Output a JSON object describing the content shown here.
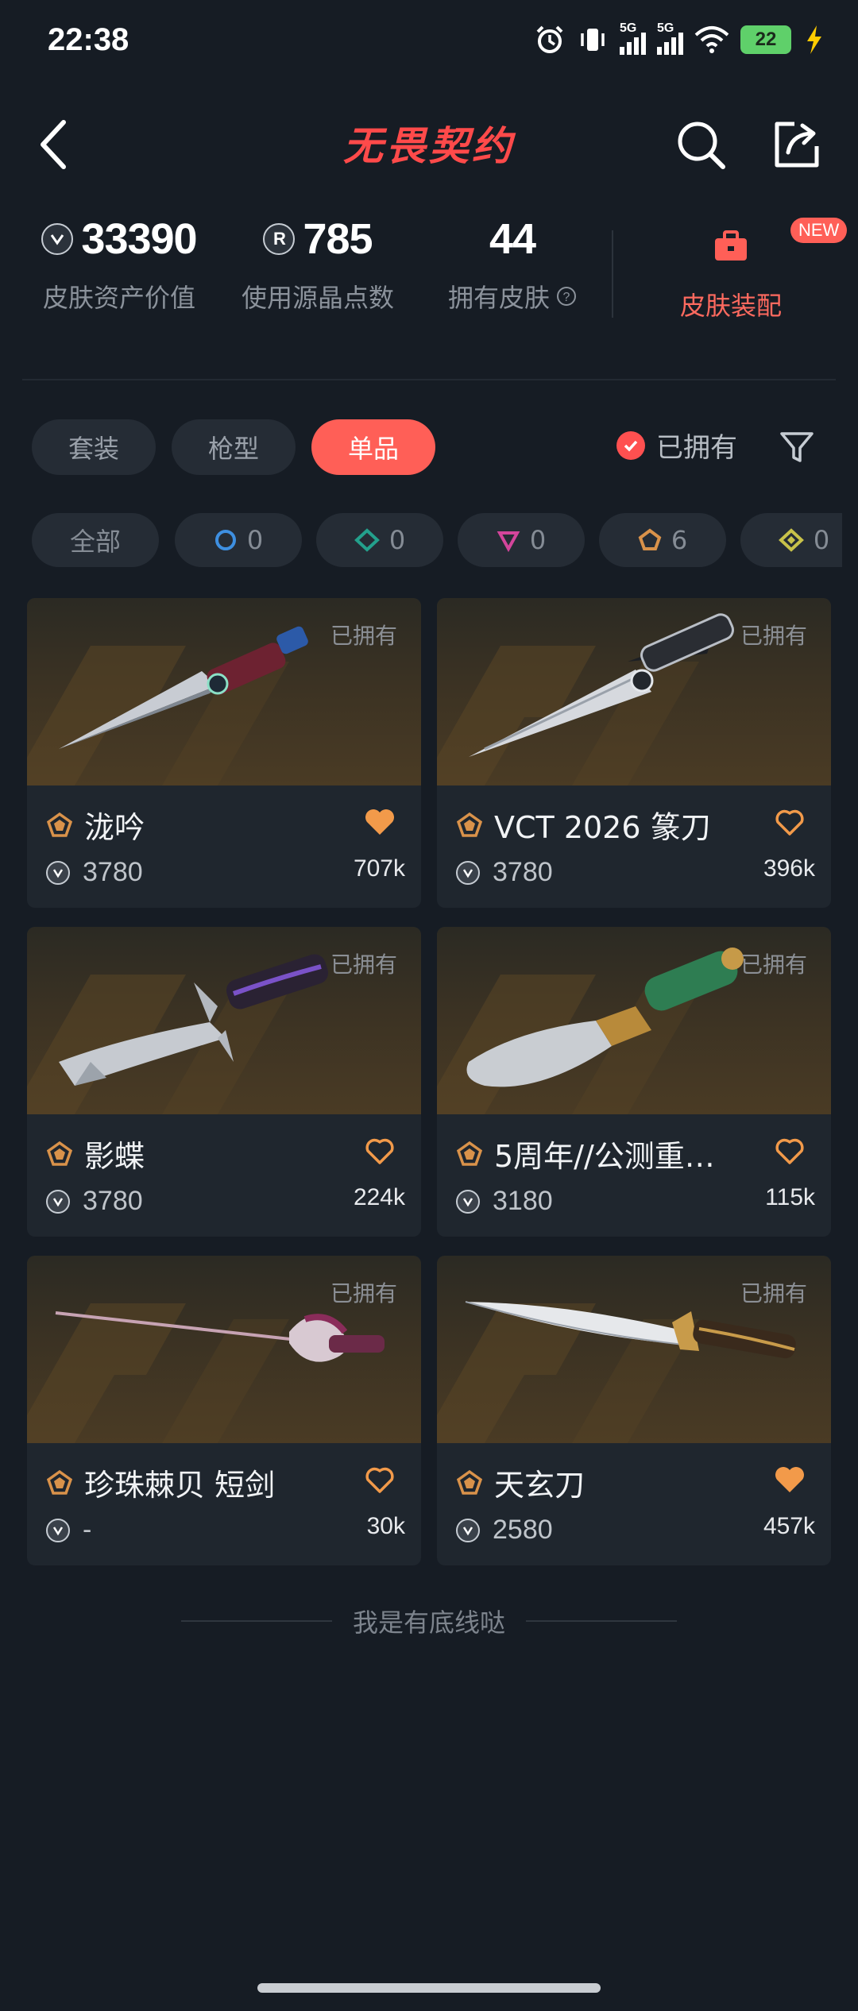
{
  "status": {
    "time": "22:38",
    "battery": "22",
    "signal1": "5G",
    "signal2": "5G"
  },
  "header": {
    "title": "无畏契约"
  },
  "stats": {
    "asset_value": "33390",
    "asset_value_label": "皮肤资产价值",
    "radianite_spent": "785",
    "radianite_spent_label": "使用源晶点数",
    "skins_owned": "44",
    "skins_owned_label": "拥有皮肤",
    "loadout_label": "皮肤装配",
    "new_badge": "NEW"
  },
  "tabs": [
    {
      "label": "套装",
      "active": false
    },
    {
      "label": "枪型",
      "active": false
    },
    {
      "label": "单品",
      "active": true
    }
  ],
  "owned_filter": {
    "label": "已拥有",
    "checked": true
  },
  "tier_chips": [
    {
      "label": "全部"
    },
    {
      "count": "0",
      "color": "#3e8fe0",
      "icon": "select-tier-icon"
    },
    {
      "count": "0",
      "color": "#23a08c",
      "icon": "deluxe-tier-icon"
    },
    {
      "count": "0",
      "color": "#d3459b",
      "icon": "premium-tier-icon"
    },
    {
      "count": "6",
      "color": "#d9924a",
      "icon": "exclusive-tier-icon"
    },
    {
      "count": "0",
      "color": "#c8c24a",
      "icon": "ultra-tier-icon"
    }
  ],
  "cards": [
    {
      "name": "泷吟",
      "price": "3780",
      "likes": "707k",
      "liked": true,
      "owned_tag": "已拥有"
    },
    {
      "name": "VCT 2026 篆刀",
      "price": "3780",
      "likes": "396k",
      "liked": false,
      "owned_tag": "已拥有"
    },
    {
      "name": "影蝶",
      "price": "3780",
      "likes": "224k",
      "liked": false,
      "owned_tag": "已拥有"
    },
    {
      "name": "5周年//公测重…",
      "price": "3180",
      "likes": "115k",
      "liked": false,
      "owned_tag": "已拥有"
    },
    {
      "name": "珍珠棘贝 短剑",
      "price": "-",
      "likes": "30k",
      "liked": false,
      "owned_tag": "已拥有"
    },
    {
      "name": "天玄刀",
      "price": "2580",
      "likes": "457k",
      "liked": true,
      "owned_tag": "已拥有"
    }
  ],
  "footer": {
    "note": "我是有底线哒"
  },
  "colors": {
    "accent": "#ff5f57",
    "background": "#161c24",
    "card": "#1f262e",
    "tier_exclusive": "#d9924a",
    "heart_liked": "#f29a4a"
  }
}
